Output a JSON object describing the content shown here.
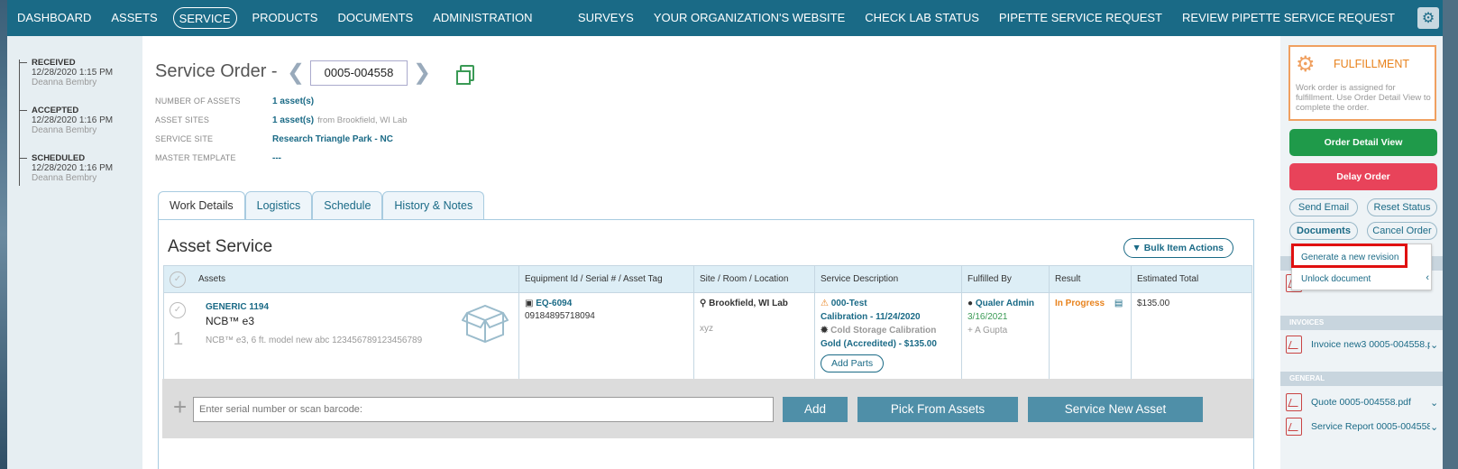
{
  "nav": {
    "items": [
      "DASHBOARD",
      "ASSETS",
      "SERVICE",
      "PRODUCTS",
      "DOCUMENTS",
      "ADMINISTRATION"
    ],
    "right_items": [
      "SURVEYS",
      "YOUR ORGANIZATION'S WEBSITE",
      "CHECK LAB STATUS",
      "PIPETTE SERVICE REQUEST",
      "REVIEW PIPETTE SERVICE REQUEST"
    ],
    "active": "SERVICE",
    "settings_icon": "gear-icon"
  },
  "timeline": [
    {
      "status": "RECEIVED",
      "date": "12/28/2020 1:15 PM",
      "user": "Deanna Bembry"
    },
    {
      "status": "ACCEPTED",
      "date": "12/28/2020 1:16 PM",
      "user": "Deanna Bembry"
    },
    {
      "status": "SCHEDULED",
      "date": "12/28/2020 1:16 PM",
      "user": "Deanna Bembry"
    }
  ],
  "order": {
    "title": "Service Order -",
    "number": "0005-004558",
    "meta": {
      "assets_label": "NUMBER OF ASSETS",
      "assets_value": "1 asset(s)",
      "sites_label": "ASSET SITES",
      "sites_value": "1 asset(s)",
      "sites_extra": "from Brookfield, WI Lab",
      "service_site_label": "SERVICE SITE",
      "service_site_value": "Research Triangle Park - NC",
      "template_label": "MASTER TEMPLATE",
      "template_value": "---"
    }
  },
  "tabs": [
    "Work Details",
    "Logistics",
    "Schedule",
    "History & Notes"
  ],
  "panel": {
    "title": "Asset Service",
    "bulk_label": "Bulk Item Actions",
    "columns": [
      "Assets",
      "Equipment Id / Serial # / Asset Tag",
      "Site / Room / Location",
      "Service Description",
      "Fulfilled By",
      "Result",
      "Estimated Total"
    ],
    "row": {
      "index": "1",
      "asset_name": "GENERIC 1194",
      "asset_model": "NCB™ e3",
      "asset_desc": "NCB™ e3, 6 ft. model new abc 123456789123456789",
      "equipment_id": "EQ-6094",
      "serial": "09184895718094",
      "site": "Brookfield, WI Lab",
      "room": "xyz",
      "service_code": "000-Test",
      "service_line1": "Calibration - 11/24/2020",
      "service_type": "Cold Storage Calibration",
      "service_line2": "Gold (Accredited) - $135.00",
      "add_parts": "Add Parts",
      "fulfilled_by": "Qualer Admin",
      "fulfilled_date": "3/16/2021",
      "fulfilled_extra": "+ A Gupta",
      "result": "In Progress",
      "total": "$135.00"
    },
    "add_bar": {
      "placeholder": "Enter serial number or scan barcode:",
      "add": "Add",
      "pick": "Pick From Assets",
      "new_asset": "Service New Asset"
    }
  },
  "sidebar": {
    "fulfillment_title": "FULFILLMENT",
    "fulfillment_text": "Work order is assigned for fulfillment. Use Order Detail View to complete the order.",
    "order_detail": "Order Detail View",
    "delay": "Delay Order",
    "send_email": "Send Email",
    "reset_status": "Reset Status",
    "documents": "Documents",
    "cancel_order": "Cancel Order",
    "menu": [
      "Generate a new revision",
      "Unlock document"
    ],
    "invoices_head": "INVOICES",
    "invoice_doc": "Invoice new3 0005-004558.pdf",
    "general_head": "GENERAL",
    "general_docs": [
      "Quote 0005-004558.pdf",
      "Service Report 0005-004558.p..."
    ],
    "colors": {
      "green": "#1f9a4a",
      "red": "#e8435a",
      "accent": "#1a6a86"
    }
  }
}
